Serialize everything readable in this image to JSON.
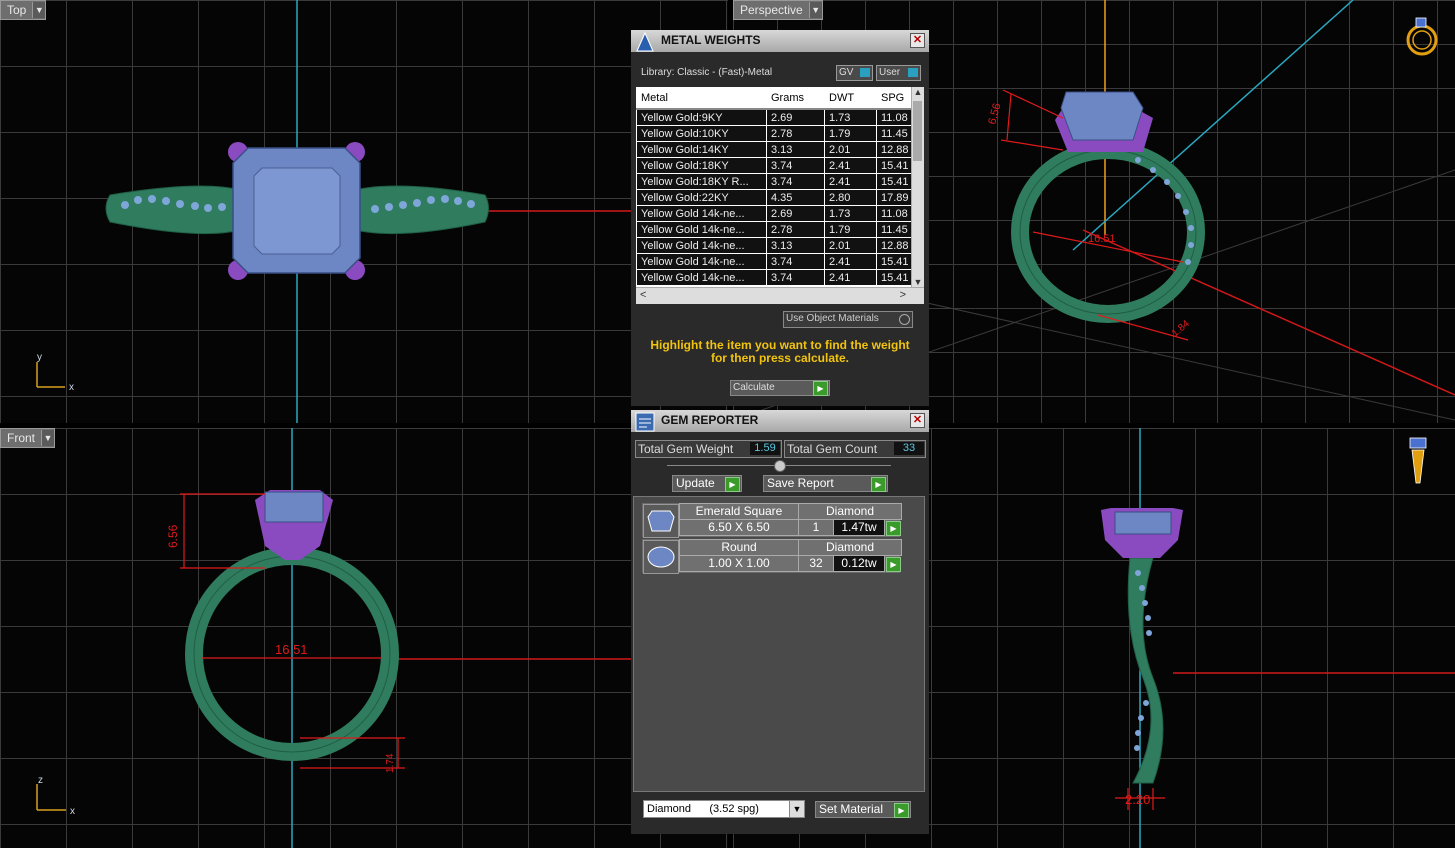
{
  "viewports": {
    "top": {
      "label": "Top"
    },
    "perspective": {
      "label": "Perspective"
    },
    "front": {
      "label": "Front"
    }
  },
  "axes": {
    "x": "x",
    "y": "y",
    "z": "z"
  },
  "dimensions": {
    "persp_height": "6.56",
    "persp_inner": "16.51",
    "persp_shank": "1.84",
    "front_height": "6.56",
    "front_inner": "16.51",
    "front_shank": "1.74",
    "side_width": "2.20"
  },
  "metal_weights": {
    "title": "METAL WEIGHTS",
    "library": "Library: Classic - (Fast)-Metal",
    "gv_label": "GV",
    "user_label": "User",
    "columns": [
      "Metal",
      "Grams",
      "DWT",
      "SPG"
    ],
    "rows": [
      [
        "Yellow Gold:9KY",
        "2.69",
        "1.73",
        "11.08"
      ],
      [
        "Yellow Gold:10KY",
        "2.78",
        "1.79",
        "11.45"
      ],
      [
        "Yellow Gold:14KY",
        "3.13",
        "2.01",
        "12.88"
      ],
      [
        "Yellow Gold:18KY",
        "3.74",
        "2.41",
        "15.41"
      ],
      [
        "Yellow Gold:18KY R...",
        "3.74",
        "2.41",
        "15.41"
      ],
      [
        "Yellow Gold:22KY",
        "4.35",
        "2.80",
        "17.89"
      ],
      [
        "Yellow Gold 14k-ne...",
        "2.69",
        "1.73",
        "11.08"
      ],
      [
        "Yellow Gold 14k-ne...",
        "2.78",
        "1.79",
        "11.45"
      ],
      [
        "Yellow Gold 14k-ne...",
        "3.13",
        "2.01",
        "12.88"
      ],
      [
        "Yellow Gold 14k-ne...",
        "3.74",
        "2.41",
        "15.41"
      ],
      [
        "Yellow Gold 14k-ne...",
        "3.74",
        "2.41",
        "15.41"
      ]
    ],
    "use_object_materials": "Use Object Materials",
    "instructions": "Highlight the item you want to find the weight for then press calculate.",
    "calculate_label": "Calculate"
  },
  "gem_reporter": {
    "title": "GEM REPORTER",
    "total_weight_label": "Total Gem Weight",
    "total_weight_value": "1.59",
    "total_count_label": "Total Gem Count",
    "total_count_value": "33",
    "update_label": "Update",
    "save_report_label": "Save Report",
    "gems": [
      {
        "shape": "Emerald Square",
        "material": "Diamond",
        "size": "6.50 X 6.50",
        "count": "1",
        "weight": "1.47tw"
      },
      {
        "shape": "Round",
        "material": "Diamond",
        "size": "1.00 X 1.00",
        "count": "32",
        "weight": "0.12tw"
      }
    ],
    "material_select": "Diamond      (3.52 spg)",
    "set_material_label": "Set Material"
  },
  "colors": {
    "metal": "#2f7d5e",
    "prong": "#8a4bc0",
    "gem": "#6d86c4",
    "accent_yellow": "#f2c40f",
    "dimension_red": "#e01a1a"
  }
}
